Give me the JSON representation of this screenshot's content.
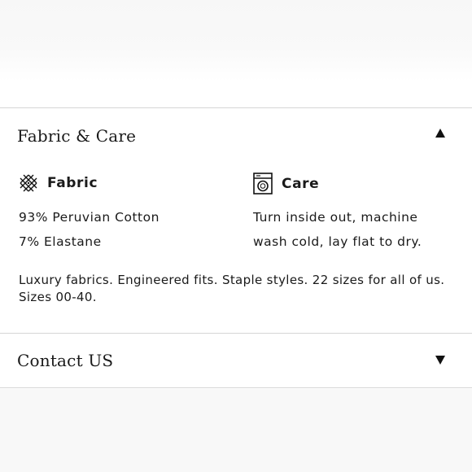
{
  "accordion": {
    "fabric_care": {
      "title": "Fabric & Care",
      "expanded": true,
      "toggle_icon": "triangle-up-icon",
      "fabric": {
        "heading": "Fabric",
        "icon": "fabric-weave-icon",
        "lines": [
          "93% Peruvian Cotton",
          "7% Elastane"
        ]
      },
      "care": {
        "heading": "Care",
        "icon": "washing-machine-icon",
        "lines": [
          "Turn inside out, machine",
          "wash cold, lay flat to dry."
        ]
      },
      "description": {
        "line1": "Luxury fabrics. Engineered fits. Staple styles. 22 sizes for all of us.",
        "line2": "Sizes 00-40."
      }
    },
    "contact": {
      "title": "Contact US",
      "expanded": false,
      "toggle_icon": "triangle-down-icon"
    }
  }
}
